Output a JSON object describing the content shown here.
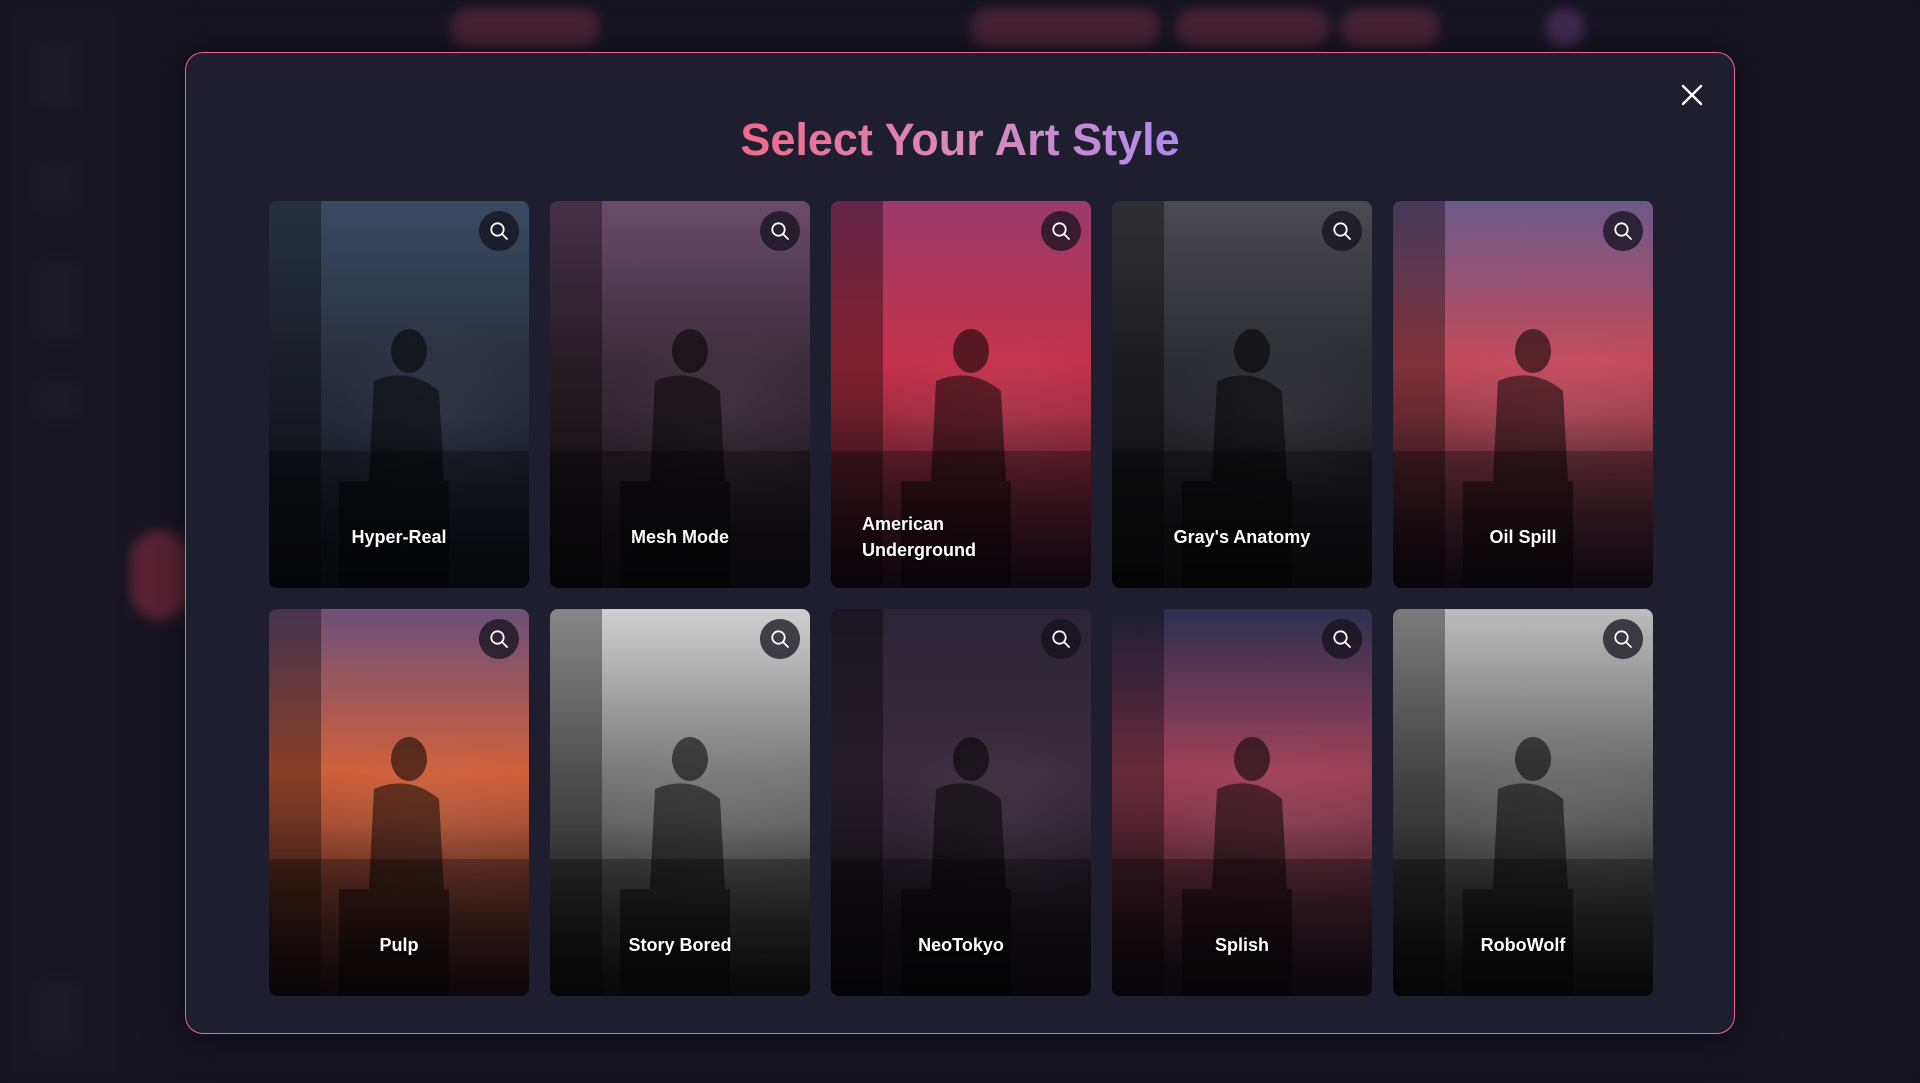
{
  "modal": {
    "title": "Select Your Art Style",
    "close_icon": "close-icon",
    "zoom_icon": "search-icon"
  },
  "colors": {
    "accent_border": "#e86a8c",
    "title_gradient_start": "#f06a8a",
    "title_gradient_end": "#b18af0",
    "modal_bg": "#1f1e2e"
  },
  "styles": [
    {
      "label": "Hyper-Real",
      "palette": [
        "#3a4a63",
        "#2a2f3e",
        "#141620"
      ]
    },
    {
      "label": "Mesh Mode",
      "palette": [
        "#6a4c6a",
        "#3a2c38",
        "#171419"
      ]
    },
    {
      "label": "American Underground",
      "palette": [
        "#9b3a6a",
        "#c4324a",
        "#2a1828"
      ]
    },
    {
      "label": "Gray's Anatomy",
      "palette": [
        "#4a4a50",
        "#2c2c33",
        "#151518"
      ]
    },
    {
      "label": "Oil Spill",
      "palette": [
        "#6a5a8a",
        "#c44a5a",
        "#221a28"
      ]
    },
    {
      "label": "Pulp",
      "palette": [
        "#6c4f7a",
        "#d0603a",
        "#241620"
      ]
    },
    {
      "label": "Story Bored",
      "palette": [
        "#d0d0d0",
        "#7a7a7a",
        "#1a1a1a"
      ]
    },
    {
      "label": "NeoTokyo",
      "palette": [
        "#2a2434",
        "#3a2c3c",
        "#120f16"
      ]
    },
    {
      "label": "Splish",
      "palette": [
        "#2c3050",
        "#a04058",
        "#18161e"
      ]
    },
    {
      "label": "RoboWolf",
      "palette": [
        "#bdbdbd",
        "#6a6a6a",
        "#161616"
      ]
    }
  ]
}
